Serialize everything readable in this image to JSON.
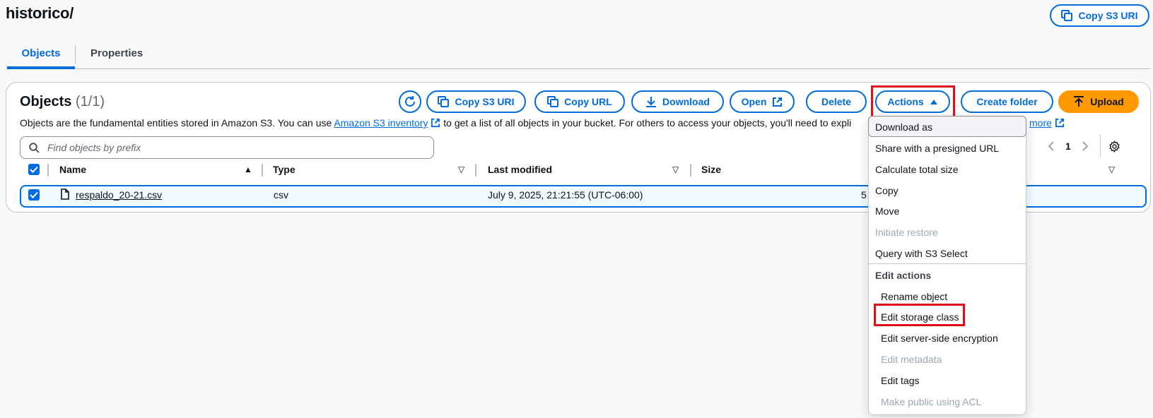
{
  "page": {
    "title": "historico/",
    "copy_s3_uri_label": "Copy S3 URI"
  },
  "tabs": [
    {
      "label": "Objects",
      "active": true
    },
    {
      "label": "Properties",
      "active": false
    }
  ],
  "objects_panel": {
    "heading": "Objects",
    "count": "(1/1)",
    "description_prefix": "Objects are the fundamental entities stored in Amazon S3. You can use",
    "inventory_link": "Amazon S3 inventory",
    "description_suffix": "to get a list of all objects in your bucket. For others to access your objects, you'll need to expli",
    "learn_more": "more",
    "toolbar": {
      "copy_s3_uri": "Copy S3 URI",
      "copy_url": "Copy URL",
      "download": "Download",
      "open": "Open",
      "delete": "Delete",
      "actions": "Actions",
      "create_folder": "Create folder",
      "upload": "Upload"
    },
    "search": {
      "placeholder": "Find objects by prefix",
      "value": ""
    },
    "pagination": {
      "page": "1"
    },
    "columns": [
      "Name",
      "Type",
      "Last modified",
      "Size"
    ],
    "rows": [
      {
        "name": "respaldo_20-21.csv",
        "type": "csv",
        "last_modified": "July 9, 2025, 21:21:55 (UTC-06:00)",
        "size_partial": "5",
        "selected": true
      }
    ]
  },
  "actions_menu": {
    "items": [
      {
        "label": "Download as",
        "disabled": false
      },
      {
        "label": "Share with a presigned URL",
        "disabled": false
      },
      {
        "label": "Calculate total size",
        "disabled": false
      },
      {
        "label": "Copy",
        "disabled": false
      },
      {
        "label": "Move",
        "disabled": false
      },
      {
        "label": "Initiate restore",
        "disabled": true
      },
      {
        "label": "Query with S3 Select",
        "disabled": false
      }
    ],
    "edit_group_label": "Edit actions",
    "edit_items": [
      {
        "label": "Rename object",
        "disabled": false
      },
      {
        "label": "Edit storage class",
        "disabled": false
      },
      {
        "label": "Edit server-side encryption",
        "disabled": false
      },
      {
        "label": "Edit metadata",
        "disabled": true
      },
      {
        "label": "Edit tags",
        "disabled": false
      },
      {
        "label": "Make public using ACL",
        "disabled": true
      }
    ]
  },
  "colors": {
    "primary": "#006ce0",
    "upload_button": "#ff9900",
    "highlight_outline": "#e0101a",
    "selected_row": "#f0fbff",
    "disabled_text": "#9ba7b6"
  },
  "icons": [
    "copy-icon",
    "refresh-icon",
    "download-icon",
    "external-link-icon",
    "caret-up-icon",
    "upload-icon",
    "search-icon",
    "chevron-left-icon",
    "chevron-right-icon",
    "gear-icon",
    "file-icon",
    "checkbox-icon",
    "sort-icon"
  ]
}
